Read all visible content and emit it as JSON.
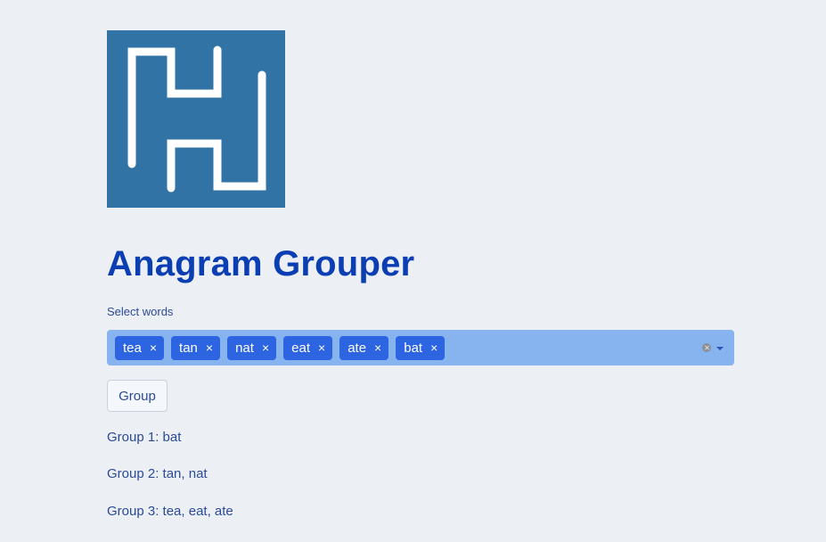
{
  "app": {
    "title": "Anagram Grouper"
  },
  "colors": {
    "background": "#ecf0f5",
    "logo_background": "#3273a6",
    "title": "#0b3eb3",
    "multiselect_background": "#87b4ef",
    "tag_background": "#2c64e2"
  },
  "select": {
    "label": "Select words",
    "tags": [
      {
        "label": "tea",
        "remove_icon": "×"
      },
      {
        "label": "tan",
        "remove_icon": "×"
      },
      {
        "label": "nat",
        "remove_icon": "×"
      },
      {
        "label": "eat",
        "remove_icon": "×"
      },
      {
        "label": "ate",
        "remove_icon": "×"
      },
      {
        "label": "bat",
        "remove_icon": "×"
      }
    ],
    "clear_icon": "clear-icon",
    "dropdown_icon": "chevron-down-icon"
  },
  "actions": {
    "group_label": "Group"
  },
  "results": [
    "Group 1: bat",
    "Group 2: tan, nat",
    "Group 3: tea, eat, ate"
  ]
}
